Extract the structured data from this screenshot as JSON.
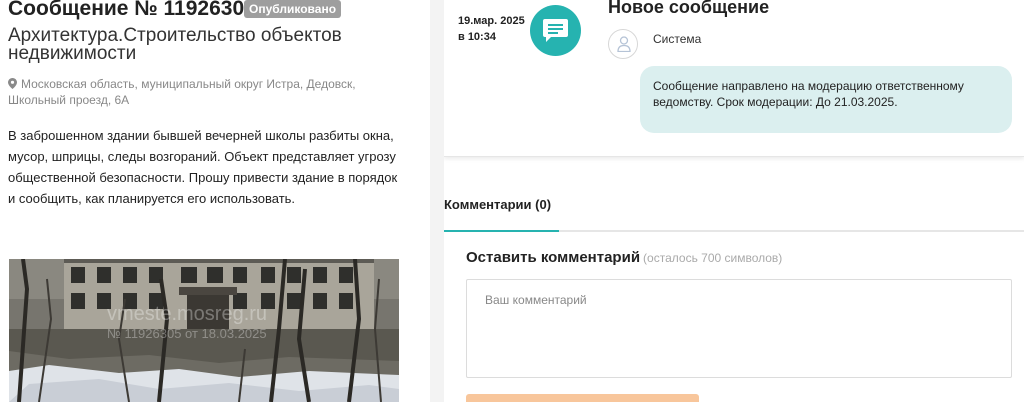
{
  "message": {
    "title": "Сообщение № 11926305",
    "status_badge": "Опубликовано",
    "category": "Архитектура.Строительство объектов недвижимости",
    "address": "Московская область, муниципальный округ Истра, Дедовск, Школьный проезд, 6А",
    "description": "В заброшенном здании бывшей вечерней школы разбиты окна, мусор, шприцы, следы возгораний. Объект представляет угрозу общественной безопасности. Прошу привести здание в порядок и сообщить, как планируется его использовать.",
    "photo": {
      "watermark_site": "vmeste.mosreg.ru",
      "watermark_id": "№ 11926305 от 18.03.2025"
    }
  },
  "timeline": {
    "date": "19.мар. 2025 в 10:34",
    "icon": "chat-bubble-icon",
    "title": "Новое сообщение",
    "sender": "Система",
    "text": "Сообщение направлено на модерацию ответственному ведомству. Срок модерации: До 21.03.2025."
  },
  "comments": {
    "tab_label": "Комментарии (0)",
    "form_title": "Оставить комментарий",
    "remaining": "(осталось 700 символов)",
    "placeholder": "Ваш комментарий"
  },
  "colors": {
    "accent": "#26b3b0",
    "bubble": "#dbefef",
    "badge": "#9e9e9e",
    "submit": "#f8c69b"
  }
}
